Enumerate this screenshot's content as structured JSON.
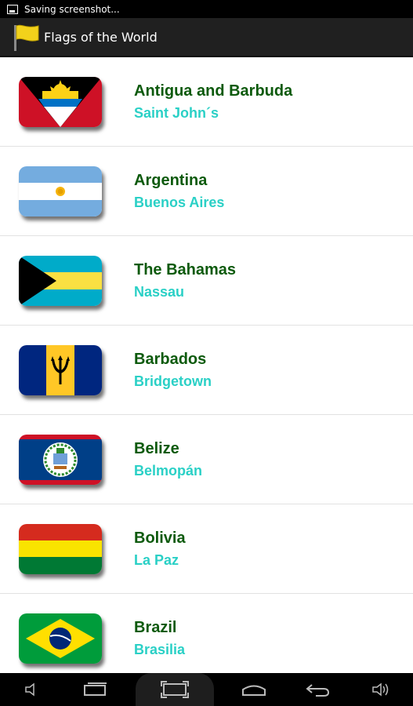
{
  "status_bar": {
    "notification": "Saving screenshot..."
  },
  "app": {
    "title": "Flags of the World",
    "icon": "yellow-flag-icon"
  },
  "countries": [
    {
      "name": "Antigua and Barbuda",
      "capital": "Saint John´s",
      "flag": "antigua-and-barbuda-flag"
    },
    {
      "name": "Argentina",
      "capital": "Buenos Aires",
      "flag": "argentina-flag"
    },
    {
      "name": "The Bahamas",
      "capital": "Nassau",
      "flag": "bahamas-flag"
    },
    {
      "name": "Barbados",
      "capital": "Bridgetown",
      "flag": "barbados-flag"
    },
    {
      "name": "Belize",
      "capital": "Belmopán",
      "flag": "belize-flag"
    },
    {
      "name": "Bolivia",
      "capital": "La Paz",
      "flag": "bolivia-flag"
    },
    {
      "name": "Brazil",
      "capital": "Brasilia",
      "flag": "brazil-flag"
    }
  ],
  "colors": {
    "country_name": "#0d5a0d",
    "capital": "#2ad0c6",
    "action_bar": "#202020"
  },
  "nav_bar": [
    "volume-down-icon",
    "recent-apps-icon",
    "screenshot-icon",
    "home-icon",
    "back-icon",
    "volume-up-icon"
  ]
}
